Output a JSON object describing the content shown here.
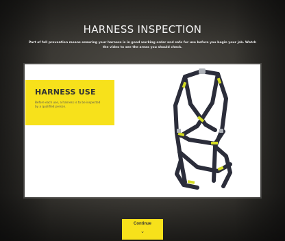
{
  "header": {
    "title": "HARNESS INSPECTION",
    "subtitle": "Part of fall prevention means ensuring your harness is in good working order and safe for use before you begin your job. Watch the video to see the areas you should check."
  },
  "card": {
    "heading": "HARNESS USE",
    "body": "Before each use, a harness is to be inspected by a qualified person."
  },
  "start_button": {
    "label": "Continue",
    "icon": "chevron-down-icon"
  },
  "colors": {
    "accent": "#f7e11b",
    "card_bg": "#ffffff",
    "harness_webbing": "#2b2d3a",
    "harness_tags": "#d4dc24"
  }
}
